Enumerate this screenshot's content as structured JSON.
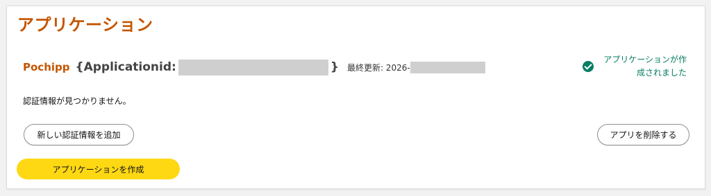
{
  "page": {
    "title": "アプリケーション"
  },
  "application": {
    "name": "Pochipp",
    "id_prefix": "{Applicationid:",
    "id_suffix": "}",
    "updated_label": "最終更新: 2026-"
  },
  "status": {
    "message": "アプリケーションが作成されました",
    "color": "#067d62",
    "icon": "check-circle-icon"
  },
  "credentials": {
    "empty_message": "認証情報が見つかりません。",
    "add_button_label": "新しい認証情報を追加"
  },
  "actions": {
    "delete_app_label": "アプリを削除する",
    "create_app_label": "アプリケーションを作成"
  },
  "colors": {
    "accent": "#c45500",
    "primary_button": "#ffd814",
    "success": "#067d62"
  }
}
